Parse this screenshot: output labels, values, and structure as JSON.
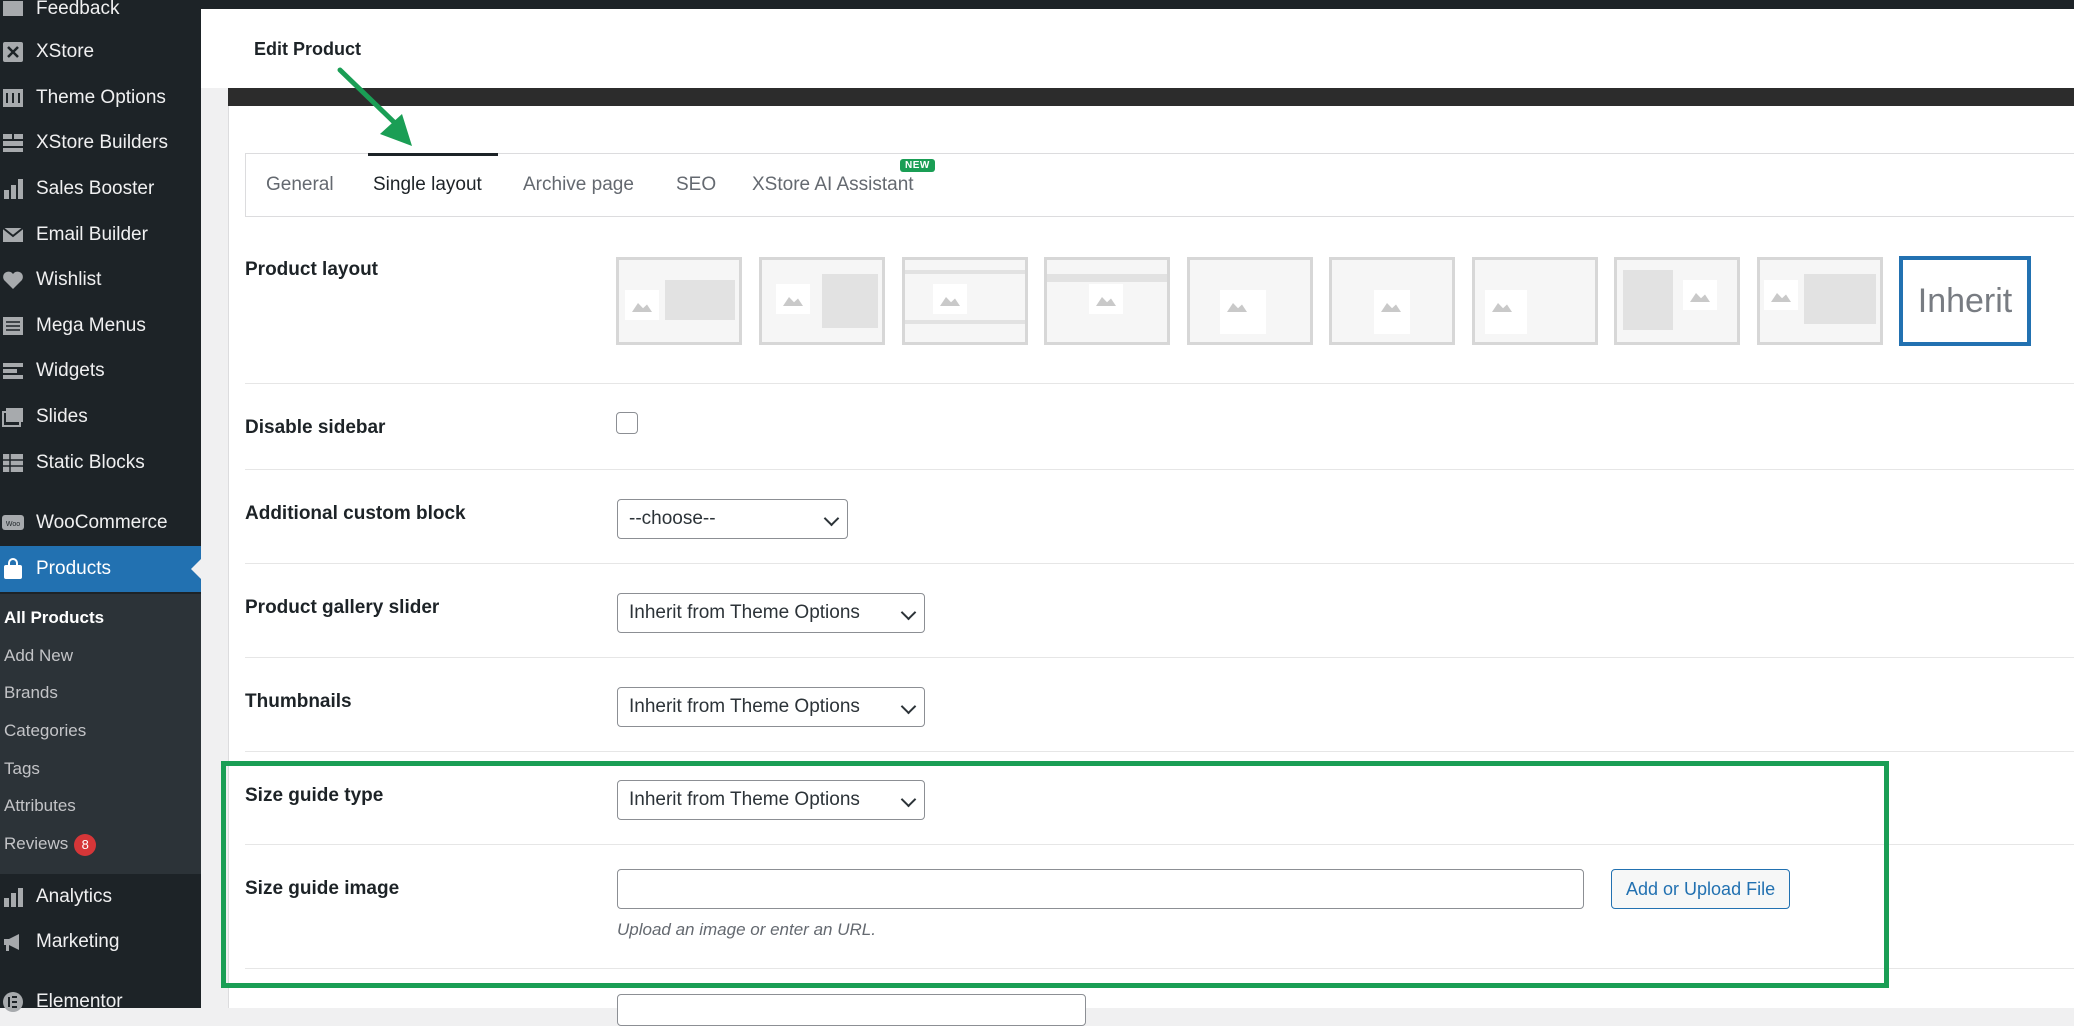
{
  "sidebar": {
    "items": [
      {
        "label": "Feedback",
        "icon": "feedback-icon"
      },
      {
        "label": "XStore",
        "icon": "xstore-icon"
      },
      {
        "label": "Theme Options",
        "icon": "theme-options-icon"
      },
      {
        "label": "XStore Builders",
        "icon": "builders-icon"
      },
      {
        "label": "Sales Booster",
        "icon": "chart-bar-icon"
      },
      {
        "label": "Email Builder",
        "icon": "email-icon"
      },
      {
        "label": "Wishlist",
        "icon": "heart-icon"
      },
      {
        "label": "Mega Menus",
        "icon": "mega-menu-icon"
      },
      {
        "label": "Widgets",
        "icon": "widgets-icon"
      },
      {
        "label": "Slides",
        "icon": "slides-icon"
      },
      {
        "label": "Static Blocks",
        "icon": "static-blocks-icon"
      },
      {
        "label": "WooCommerce",
        "icon": "woocommerce-icon"
      },
      {
        "label": "Products",
        "icon": "products-bag-icon"
      },
      {
        "label": "Analytics",
        "icon": "analytics-icon"
      },
      {
        "label": "Marketing",
        "icon": "megaphone-icon"
      },
      {
        "label": "Elementor",
        "icon": "elementor-icon"
      }
    ],
    "submenu": [
      "All Products",
      "Add New",
      "Brands",
      "Categories",
      "Tags",
      "Attributes",
      "Reviews"
    ],
    "reviews_count": "8"
  },
  "header": {
    "title": "Edit Product"
  },
  "tabs": [
    {
      "label": "General"
    },
    {
      "label": "Single layout"
    },
    {
      "label": "Archive page"
    },
    {
      "label": "SEO"
    },
    {
      "label": "XStore AI Assistant"
    }
  ],
  "new_badge": "NEW",
  "fields": {
    "product_layout": {
      "label": "Product layout",
      "inherit_label": "Inherit"
    },
    "disable_sidebar": {
      "label": "Disable sidebar"
    },
    "custom_block": {
      "label": "Additional custom block",
      "value": "--choose--"
    },
    "gallery_slider": {
      "label": "Product gallery slider",
      "value": "Inherit from Theme Options"
    },
    "thumbnails": {
      "label": "Thumbnails",
      "value": "Inherit from Theme Options"
    },
    "size_guide_type": {
      "label": "Size guide type",
      "value": "Inherit from Theme Options"
    },
    "size_guide_image": {
      "label": "Size guide image",
      "value": "",
      "button": "Add or Upload File",
      "hint": "Upload an image or enter an URL."
    }
  },
  "colors": {
    "highlight": "#1a9e55",
    "accent": "#2271b1",
    "sidebar_bg": "#1d2327"
  }
}
